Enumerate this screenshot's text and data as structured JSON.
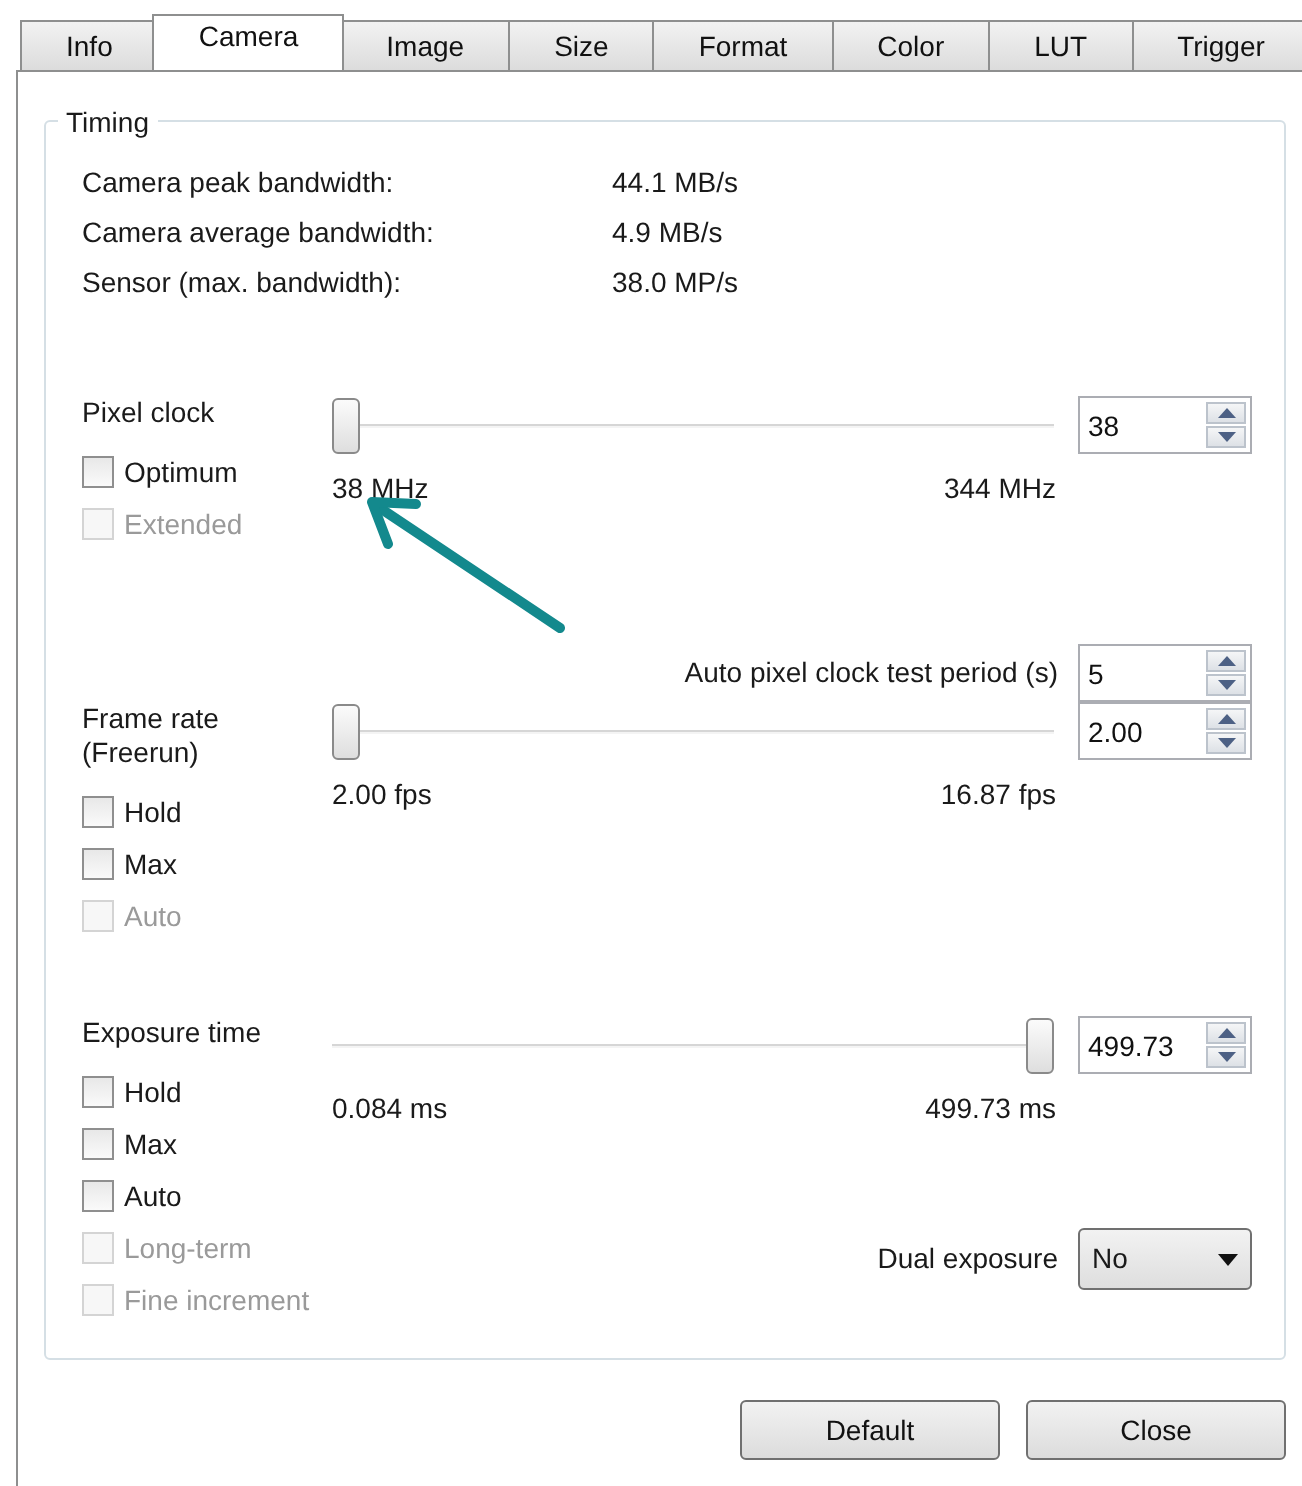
{
  "tabs": [
    {
      "label": "Info",
      "selected": false
    },
    {
      "label": "Camera",
      "selected": true
    },
    {
      "label": "Image",
      "selected": false
    },
    {
      "label": "Size",
      "selected": false
    },
    {
      "label": "Format",
      "selected": false
    },
    {
      "label": "Color",
      "selected": false
    },
    {
      "label": "LUT",
      "selected": false
    },
    {
      "label": "Trigger",
      "selected": false
    }
  ],
  "group": {
    "title": "Timing",
    "stats": [
      {
        "label": "Camera peak bandwidth:",
        "value": "44.1 MB/s"
      },
      {
        "label": "Camera average bandwidth:",
        "value": "4.9 MB/s"
      },
      {
        "label": "Sensor (max. bandwidth):",
        "value": "38.0 MP/s"
      }
    ],
    "sections": [
      {
        "label": [
          "Pixel clock"
        ],
        "level": 0,
        "spin": "38",
        "min_label": "38 MHz",
        "max_label": "344 MHz",
        "checkboxes": [
          {
            "label": "Optimum",
            "checked": false,
            "disabled": false
          },
          {
            "label": "Extended",
            "checked": false,
            "disabled": true
          }
        ],
        "extras": [
          {
            "kind": "spin",
            "label": "Auto pixel clock test period (s)",
            "value": "5"
          }
        ]
      },
      {
        "label": [
          "Frame rate",
          "(Freerun)"
        ],
        "level": 0,
        "spin": "2.00",
        "min_label": "2.00 fps",
        "max_label": "16.87 fps",
        "checkboxes": [
          {
            "label": "Hold",
            "checked": false,
            "disabled": false
          },
          {
            "label": "Max",
            "checked": false,
            "disabled": false
          },
          {
            "label": "Auto",
            "checked": false,
            "disabled": true
          }
        ]
      },
      {
        "label": [
          "Exposure time"
        ],
        "level": 1,
        "spin": "499.73",
        "min_label": "0.084 ms",
        "max_label": "499.73 ms",
        "checkboxes": [
          {
            "label": "Hold",
            "checked": false,
            "disabled": false
          },
          {
            "label": "Max",
            "checked": false,
            "disabled": false
          },
          {
            "label": "Auto",
            "checked": false,
            "disabled": false
          },
          {
            "label": "Long-term",
            "checked": false,
            "disabled": true
          },
          {
            "label": "Fine increment",
            "checked": false,
            "disabled": true
          }
        ],
        "extras": [
          {
            "kind": "dropdown",
            "label": "Dual exposure",
            "value": "No"
          }
        ]
      }
    ]
  },
  "buttons": [
    "Default",
    "Close"
  ]
}
